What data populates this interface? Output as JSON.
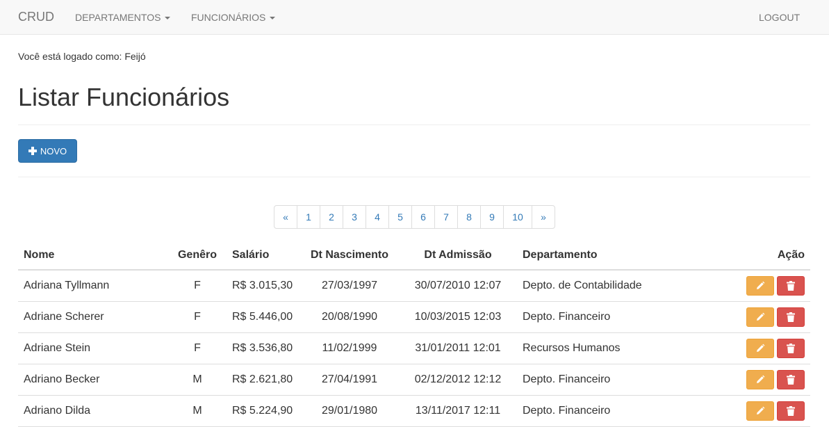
{
  "navbar": {
    "brand": "CRUD",
    "menu_departamentos": "DEPARTAMENTOS",
    "menu_funcionarios": "FUNCIONÁRIOS",
    "logout": "LOGOUT"
  },
  "user_info": "Você está logado como: Feijó",
  "page_title": "Listar Funcionários",
  "new_button": {
    "label": "NOVO",
    "icon": "plus-icon"
  },
  "pagination": {
    "prev": "«",
    "pages": [
      "1",
      "2",
      "3",
      "4",
      "5",
      "6",
      "7",
      "8",
      "9",
      "10"
    ],
    "next": "»"
  },
  "table": {
    "headers": {
      "nome": "Nome",
      "genero": "Genêro",
      "salario": "Salário",
      "dt_nascimento": "Dt Nascimento",
      "dt_admissao": "Dt Admissão",
      "departamento": "Departamento",
      "acao": "Ação"
    },
    "rows": [
      {
        "nome": "Adriana Tyllmann",
        "genero": "F",
        "salario": "R$ 3.015,30",
        "dt_nascimento": "27/03/1997",
        "dt_admissao": "30/07/2010 12:07",
        "departamento": "Depto. de Contabilidade"
      },
      {
        "nome": "Adriane Scherer",
        "genero": "F",
        "salario": "R$ 5.446,00",
        "dt_nascimento": "20/08/1990",
        "dt_admissao": "10/03/2015 12:03",
        "departamento": "Depto. Financeiro"
      },
      {
        "nome": "Adriane Stein",
        "genero": "F",
        "salario": "R$ 3.536,80",
        "dt_nascimento": "11/02/1999",
        "dt_admissao": "31/01/2011 12:01",
        "departamento": "Recursos Humanos"
      },
      {
        "nome": "Adriano Becker",
        "genero": "M",
        "salario": "R$ 2.621,80",
        "dt_nascimento": "27/04/1991",
        "dt_admissao": "02/12/2012 12:12",
        "departamento": "Depto. Financeiro"
      },
      {
        "nome": "Adriano Dilda",
        "genero": "M",
        "salario": "R$ 5.224,90",
        "dt_nascimento": "29/01/1980",
        "dt_admissao": "13/11/2017 12:11",
        "departamento": "Depto. Financeiro"
      }
    ],
    "edit_icon": "pencil-icon",
    "delete_icon": "trash-icon"
  },
  "colors": {
    "primary": "#337ab7",
    "warning": "#f0ad4e",
    "danger": "#d9534f"
  }
}
